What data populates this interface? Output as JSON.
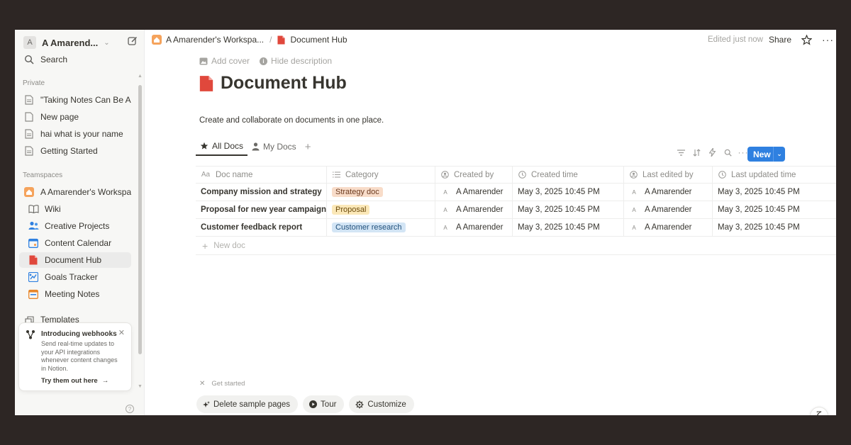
{
  "sidebar": {
    "workspace_initial": "A",
    "workspace_name": "A Amarend...",
    "search_label": "Search",
    "private_label": "Private",
    "private_items": [
      {
        "label": "\"Taking Notes Can Be A..."
      },
      {
        "label": "New page"
      },
      {
        "label": "hai what is your name"
      },
      {
        "label": "Getting Started"
      }
    ],
    "teamspaces_label": "Teamspaces",
    "teamspace_name": "A Amarender's Workspa...",
    "team_items": [
      {
        "label": "Wiki",
        "icon": "book-icon"
      },
      {
        "label": "Creative Projects",
        "icon": "people-icon"
      },
      {
        "label": "Content Calendar",
        "icon": "calendar-icon"
      },
      {
        "label": "Document Hub",
        "icon": "document-icon",
        "active": true
      },
      {
        "label": "Goals Tracker",
        "icon": "goals-icon"
      },
      {
        "label": "Meeting Notes",
        "icon": "meeting-icon"
      }
    ],
    "templates_label": "Templates",
    "webhook": {
      "title": "Introducing webhooks",
      "body": "Send real-time updates to your API integrations whenever content changes in Notion.",
      "link": "Try them out here"
    }
  },
  "topbar": {
    "crumb_workspace": "A Amarender's Workspa...",
    "crumb_separator": "/",
    "crumb_page": "Document Hub",
    "edited": "Edited just now",
    "share": "Share"
  },
  "page": {
    "add_cover": "Add cover",
    "hide_description": "Hide description",
    "title": "Document Hub",
    "description": "Create and collaborate on documents in one place.",
    "tabs": [
      {
        "label": "All Docs",
        "active": true
      },
      {
        "label": "My Docs",
        "active": false
      }
    ],
    "new_button": "New"
  },
  "table": {
    "columns": [
      {
        "label": "Doc name",
        "icon": "Aa"
      },
      {
        "label": "Category",
        "icon": "list-icon"
      },
      {
        "label": "Created by",
        "icon": "person-icon"
      },
      {
        "label": "Created time",
        "icon": "clock-icon"
      },
      {
        "label": "Last edited by",
        "icon": "person-icon"
      },
      {
        "label": "Last updated time",
        "icon": "clock-icon"
      }
    ],
    "rows": [
      {
        "name": "Company mission and strategy",
        "category": "Strategy doc",
        "category_bg": "#f8dcc9",
        "category_fg": "#6b3a1f",
        "created_by": "A Amarender",
        "created_time": "May 3, 2025 10:45 PM",
        "edited_by": "A Amarender",
        "updated_time": "May 3, 2025 10:45 PM"
      },
      {
        "name": "Proposal for new year campaign",
        "category": "Proposal",
        "category_bg": "#fbe8b8",
        "category_fg": "#6b4a0c",
        "created_by": "A Amarender",
        "created_time": "May 3, 2025 10:45 PM",
        "edited_by": "A Amarender",
        "updated_time": "May 3, 2025 10:45 PM"
      },
      {
        "name": "Customer feedback report",
        "category": "Customer research",
        "category_bg": "#d3e5f5",
        "category_fg": "#1f4f7a",
        "created_by": "A Amarender",
        "created_time": "May 3, 2025 10:45 PM",
        "edited_by": "A Amarender",
        "updated_time": "May 3, 2025 10:45 PM"
      }
    ],
    "avatar_initial": "A",
    "new_doc": "New doc"
  },
  "get_started": {
    "label": "Get started",
    "buttons": [
      {
        "label": "Delete sample pages",
        "icon": "sparkle-icon"
      },
      {
        "label": "Tour",
        "icon": "play-icon"
      },
      {
        "label": "Customize",
        "icon": "gear-icon"
      }
    ],
    "help": "?"
  },
  "colors": {
    "accent": "#2f80e0",
    "doc_red": "#e0483c"
  }
}
